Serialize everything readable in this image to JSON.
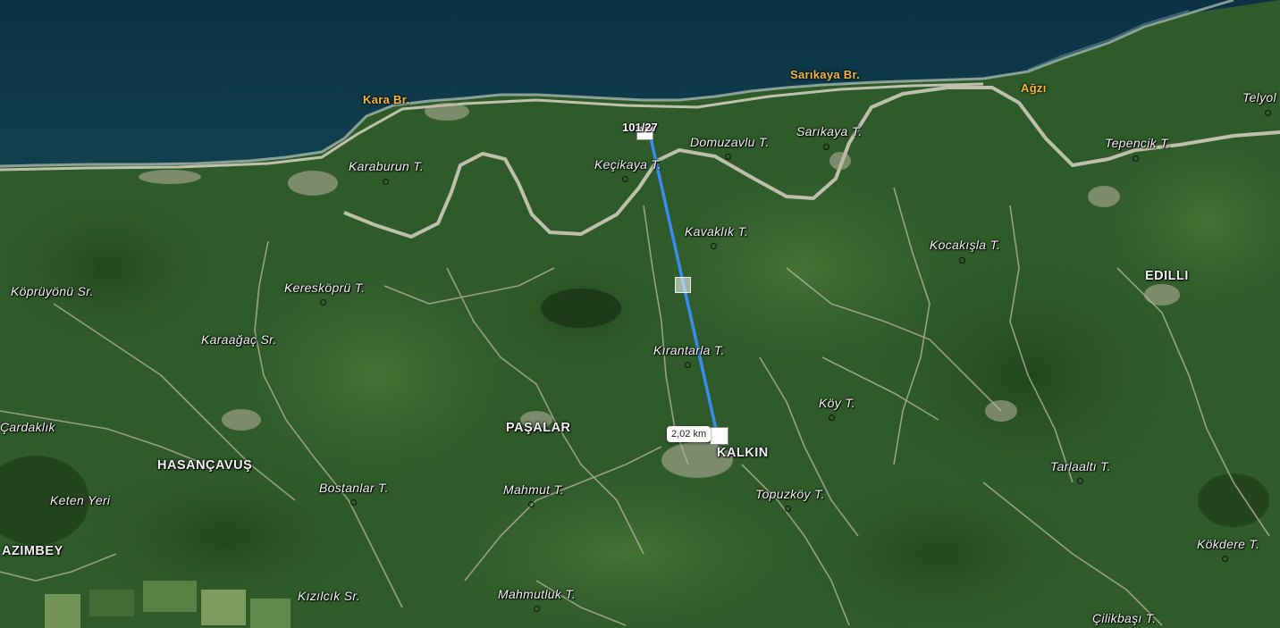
{
  "map": {
    "measurement": {
      "start_label": "101/27",
      "distance": "2,02 km",
      "line_color": "#3b8cf2"
    },
    "coastal_labels": {
      "kara": "Kara Br.",
      "sarikaya": "Sarıkaya Br.",
      "agzi": "Ağzı"
    },
    "settlements": {
      "pasalar": "PAŞALAR",
      "kalkin": "KALKIN",
      "hasancavus": "HASANÇAVUŞ",
      "edilli": "EDILLI",
      "azimbey": "AZIMBEY"
    },
    "features": {
      "karaburun": "Karaburun T.",
      "kecikaya": "Keçikaya T.",
      "domuzavlu": "Domuzavlu T.",
      "sarikaya_t": "Sarıkaya T.",
      "telyol": "Telyol",
      "tepencik": "Tepencik T.",
      "kavaklik": "Kavaklık T.",
      "kocakisla": "Kocakışla T.",
      "kopruyonu": "Köprüyönü Sr.",
      "kereskopru": "Keresköprü T.",
      "karaagac": "Karaağaç Sr.",
      "kirantarla": "Kırantarla T.",
      "koy": "Köy T.",
      "cardaklik": "Çardaklık",
      "tarlaalti": "Tarlaaltı T.",
      "bostanlar": "Bostanlar T.",
      "mahmut": "Mahmut T.",
      "topuzkoy": "Topuzköy T.",
      "keten_yeri": "Keten Yeri",
      "kokdere": "Kökdere T.",
      "kizilcik": "Kızılcık Sr.",
      "mahmutluk": "Mahmutluk T.",
      "cilikbasi": "Çilikbaşı T."
    },
    "colors": {
      "sea": "#0f3a4a",
      "land": "#2e5a2a",
      "road": "#cfcabb",
      "coast_label": "#f5b73a"
    }
  }
}
